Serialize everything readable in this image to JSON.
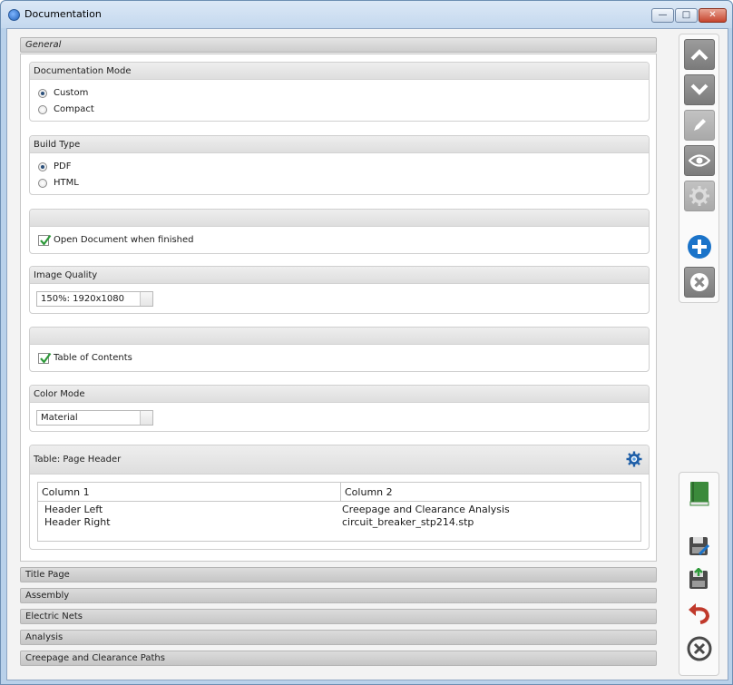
{
  "window": {
    "title": "Documentation",
    "controls": {
      "minimize": "—",
      "maximize": "□",
      "close": "✕"
    }
  },
  "general": {
    "label": "General",
    "documentation_mode": {
      "header": "Documentation Mode",
      "options": [
        {
          "label": "Custom",
          "selected": true
        },
        {
          "label": "Compact",
          "selected": false
        }
      ]
    },
    "build_type": {
      "header": "Build Type",
      "options": [
        {
          "label": "PDF",
          "selected": true
        },
        {
          "label": "HTML",
          "selected": false
        }
      ]
    },
    "open_document": {
      "label": "Open Document when finished",
      "checked": true
    },
    "image_quality": {
      "header": "Image Quality",
      "value": "150%: 1920x1080"
    },
    "table_of_contents": {
      "label": "Table of Contents",
      "checked": true
    },
    "color_mode": {
      "header": "Color Mode",
      "value": "Material"
    },
    "page_header_table": {
      "header": "Table: Page Header",
      "columns": [
        "Column 1",
        "Column 2"
      ],
      "rows": [
        [
          "Header Left",
          "Creepage and Clearance Analysis"
        ],
        [
          "Header Right",
          "circuit_breaker_stp214.stp"
        ]
      ]
    }
  },
  "sections": [
    {
      "label": "Title Page"
    },
    {
      "label": "Assembly"
    },
    {
      "label": "Electric Nets"
    },
    {
      "label": "Analysis"
    },
    {
      "label": "Creepage and Clearance Paths"
    }
  ],
  "toolbar_top": [
    "chevron-up-icon",
    "chevron-down-icon",
    "pencil-icon",
    "eye-icon",
    "gear-icon",
    "add-icon",
    "delete-icon"
  ],
  "toolbar_bottom": [
    "book-icon",
    "save-as-icon",
    "save-icon",
    "undo-icon",
    "close-circle-icon"
  ],
  "colors": {
    "accent_blue": "#1a73c9",
    "check_green": "#2e9a3a",
    "undo_red": "#c0392b",
    "book_green": "#3b8a3b"
  }
}
